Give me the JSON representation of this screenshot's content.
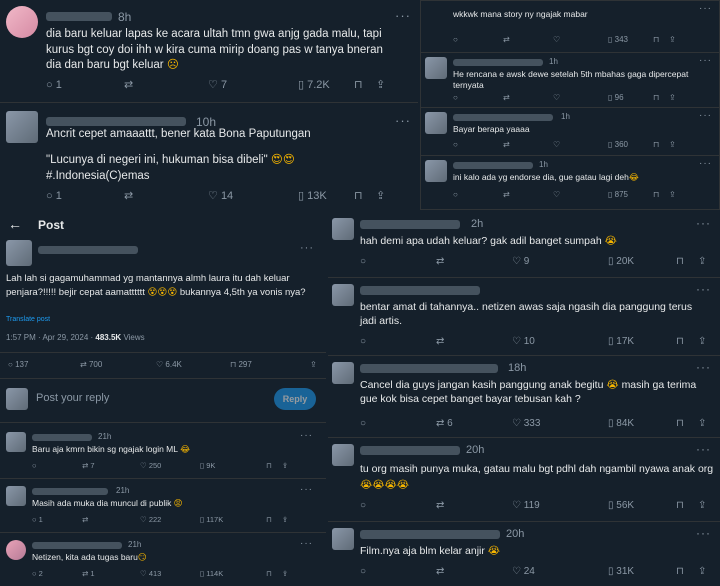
{
  "top_left": [
    {
      "time": "8h",
      "text": "dia baru keluar lapas ke acara ultah tmn gwa anjg gada malu, tapi kurus bgt coy doi ihh w kira cuma mirip doang pas w tanya bneran dia dan baru bgt keluar",
      "emoji": "☹",
      "replies": "1",
      "reposts": "",
      "likes": "7",
      "views": "7.2K"
    },
    {
      "time": "10h",
      "text": "Ancrit cepet amaaattt, bener kata Bona Paputungan",
      "quote": "\"Lucunya di negeri ini, hukuman bisa dibeli\"",
      "emoji": "😍😍",
      "hashtag": "#.Indonesia(C)emas",
      "replies": "1",
      "reposts": "",
      "likes": "14",
      "views": "13K"
    }
  ],
  "top_right": [
    {
      "time": "",
      "text": "wkkwk mana story ny ngajak mabar",
      "replies": "",
      "reposts": "",
      "likes": "",
      "views": "343"
    },
    {
      "time": "1h",
      "text": "He rencana e awsk dewe setelah 5th mbahas gaga dipercepat ternyata",
      "replies": "",
      "reposts": "",
      "likes": "",
      "views": "96"
    },
    {
      "time": "1h",
      "text": "Bayar berapa yaaaa",
      "replies": "",
      "reposts": "",
      "likes": "",
      "views": "360"
    },
    {
      "time": "1h",
      "text": "ini kalo ada yg endorse dia, gue gatau lagi deh",
      "emoji": "😂",
      "replies": "",
      "reposts": "",
      "likes": "",
      "views": "875"
    }
  ],
  "post": {
    "back_icon": "arrow-left-icon",
    "header": "Post",
    "text": "Lah lah si gagamuhammad yg mantannya almh laura itu dah keluar penjara?!!!!! bejir cepat aamatttttt",
    "emoji": "😵😵😵",
    "text_after": "bukannya 4,5th ya vonis nya?",
    "translate": "Translate post",
    "meta_time": "1:57 PM · Apr 29, 2024 ·",
    "views": "483.5K",
    "views_label": "Views",
    "replies": "137",
    "reposts": "700",
    "likes": "6.4K",
    "bookmarks": "297",
    "reply_placeholder": "Post your reply",
    "reply_button": "Reply",
    "comments": [
      {
        "time": "21h",
        "text": "Baru aja kmrn bikin sg ngajak login ML",
        "emoji": "😂",
        "replies": "",
        "reposts": "7",
        "likes": "250",
        "views": "9K"
      },
      {
        "time": "21h",
        "text": "Masih ada muka dia muncul di publik",
        "emoji": "😡",
        "replies": "1",
        "reposts": "",
        "likes": "222",
        "views": "117K"
      },
      {
        "time": "21h",
        "text": "Netizen, kita ada tugas baru",
        "emoji": "😏",
        "replies": "2",
        "reposts": "1",
        "likes": "413",
        "views": "114K"
      }
    ]
  },
  "bottom_right": [
    {
      "time": "2h",
      "text": "hah demi apa udah keluar? gak adil banget sumpah",
      "emoji": "😭",
      "replies": "",
      "reposts": "",
      "likes": "9",
      "views": "20K"
    },
    {
      "time": "",
      "text": "bentar amat di tahannya.. netizen awas saja ngasih dia panggung terus jadi artis.",
      "replies": "",
      "reposts": "",
      "likes": "10",
      "views": "17K"
    },
    {
      "time": "18h",
      "text": "Cancel dia guys jangan kasih panggung anak begitu",
      "emoji": "😭",
      "text_after": "masih ga terima gue kok bisa cepet banget bayar tebusan kah ?",
      "replies": "",
      "reposts": "6",
      "likes": "333",
      "views": "84K"
    },
    {
      "time": "20h",
      "text": "tu org masih punya muka, gatau malu bgt pdhl dah ngambil nyawa anak org",
      "emoji": "😭😭😭😭",
      "replies": "",
      "reposts": "",
      "likes": "119",
      "views": "56K"
    },
    {
      "time": "20h",
      "text": "Film.nya aja blm kelar anjir",
      "emoji": "😭",
      "replies": "",
      "reposts": "",
      "likes": "24",
      "views": "31K"
    }
  ]
}
